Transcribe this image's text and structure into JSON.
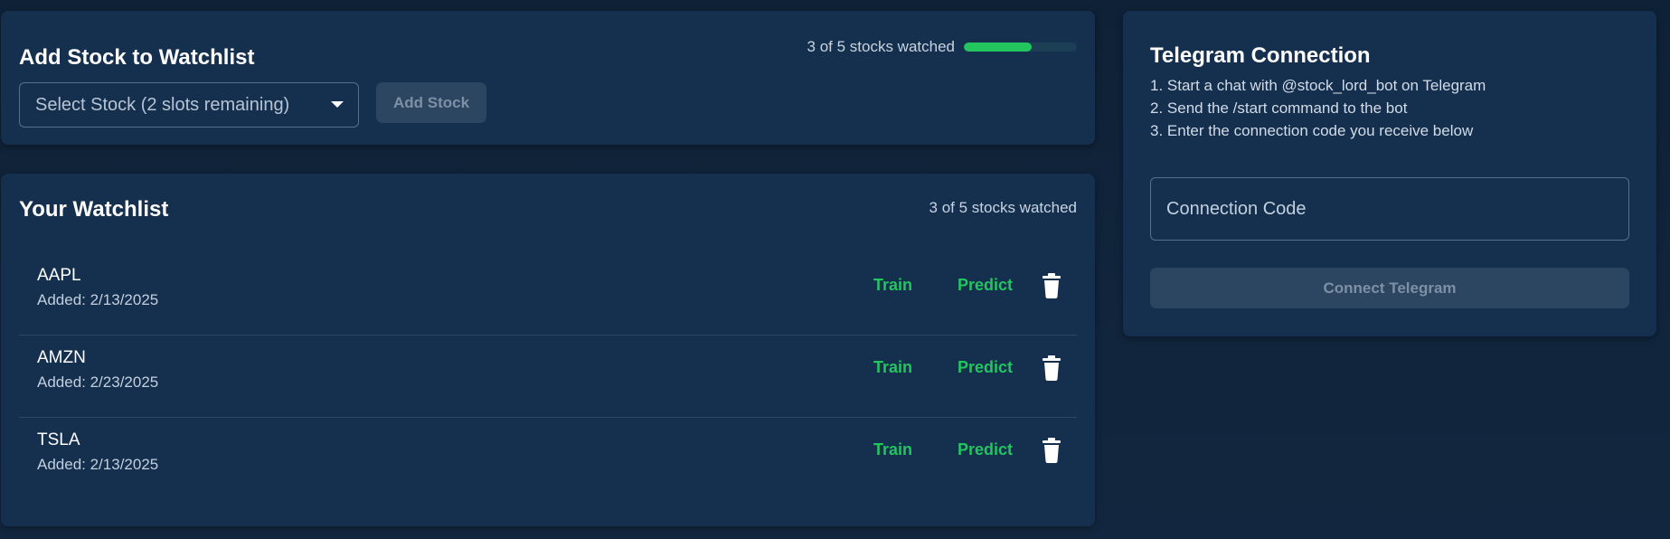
{
  "add_card": {
    "title": "Add Stock to Watchlist",
    "quota_text": "3 of 5 stocks watched",
    "quota_progress": 0.6,
    "select_placeholder": "Select Stock (2 slots remaining)",
    "add_button": "Add Stock"
  },
  "watchlist": {
    "title": "Your Watchlist",
    "quota_text": "3 of 5 stocks watched",
    "train_label": "Train",
    "predict_label": "Predict",
    "items": [
      {
        "symbol": "AAPL",
        "added": "Added: 2/13/2025"
      },
      {
        "symbol": "AMZN",
        "added": "Added: 2/23/2025"
      },
      {
        "symbol": "TSLA",
        "added": "Added: 2/13/2025"
      }
    ]
  },
  "telegram": {
    "title": "Telegram Connection",
    "steps": [
      "1. Start a chat with @stock_lord_bot on Telegram",
      "2. Send the /start command to the bot",
      "3. Enter the connection code you receive below"
    ],
    "code_placeholder": "Connection Code",
    "connect_button": "Connect Telegram"
  },
  "colors": {
    "accent_green": "#22c55e",
    "card_bg": "#15304f",
    "page_bg": "#10233b",
    "disabled_button": "#2c4560"
  },
  "icons": {
    "delete": "trash-icon",
    "dropdown": "chevron-down-icon"
  }
}
